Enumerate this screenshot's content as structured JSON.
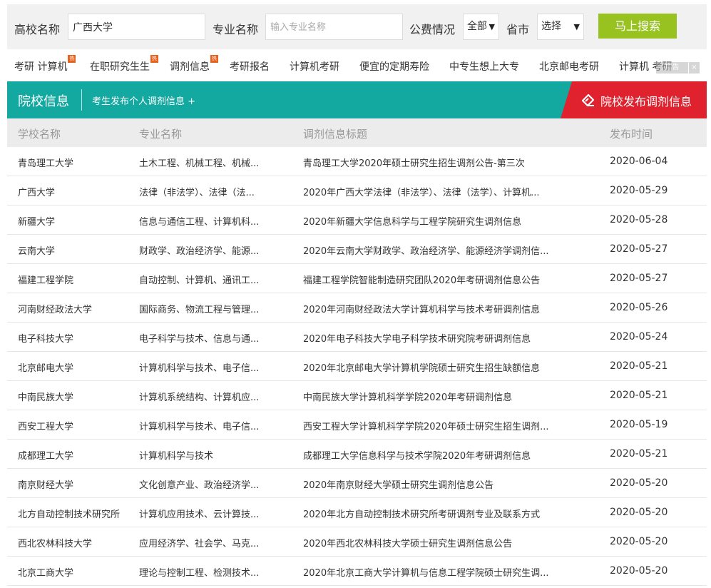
{
  "search": {
    "school_label": "高校名称",
    "school_value": "广西大学",
    "major_label": "专业名称",
    "major_placeholder": "输入专业名称",
    "funding_label": "公费情况",
    "funding_selected": "全部",
    "province_label": "省市",
    "province_selected": "选择",
    "submit_label": "马上搜索"
  },
  "hotlinks": [
    {
      "label": "考研 计算机",
      "hot": "热"
    },
    {
      "label": "在职研究生生",
      "hot": "热"
    },
    {
      "label": "调剂信息",
      "hot": "热"
    },
    {
      "label": "考研报名",
      "hot": ""
    },
    {
      "label": "计算机考研",
      "hot": ""
    },
    {
      "label": "便宜的定期寿险",
      "hot": ""
    },
    {
      "label": "中专生想上大专",
      "hot": ""
    },
    {
      "label": "北京邮电考研",
      "hot": ""
    },
    {
      "label": "计算机 考研",
      "hot": ""
    }
  ],
  "ad": {
    "label": "广告",
    "close": "×"
  },
  "tabs": {
    "title": "院校信息",
    "publish_personal": "考生发布个人调剂信息 +",
    "publish_school": "院校发布调剂信息"
  },
  "table": {
    "headers": [
      "学校名称",
      "专业名称",
      "调剂信息标题",
      "发布时间"
    ],
    "rows": [
      [
        "青岛理工大学",
        "土木工程、机械工程、机械...",
        "青岛理工大学2020年硕士研究生招生调剂公告-第三次",
        "2020-06-04"
      ],
      [
        "广西大学",
        "法律（非法学）、法律（法...",
        "2020年广西大学法律（非法学）、法律（法学）、计算机...",
        "2020-05-29"
      ],
      [
        "新疆大学",
        "信息与通信工程、计算机科...",
        "2020年新疆大学信息科学与工程学院研究生调剂信息",
        "2020-05-28"
      ],
      [
        "云南大学",
        "财政学、政治经济学、能源...",
        "2020年云南大学财政学、政治经济学、能源经济学调剂信...",
        "2020-05-27"
      ],
      [
        "福建工程学院",
        "自动控制、计算机、通讯工...",
        "福建工程学院智能制造研究团队2020年考研调剂信息公告",
        "2020-05-27"
      ],
      [
        "河南财经政法大学",
        "国际商务、物流工程与管理...",
        "2020年河南财经政法大学计算机科学与技术考研调剂信息",
        "2020-05-26"
      ],
      [
        "电子科技大学",
        "电子科学与技术、信息与通...",
        "2020年电子科技大学电子科学技术研究院考研调剂信息",
        "2020-05-24"
      ],
      [
        "北京邮电大学",
        "计算机科学与技术、电子信...",
        "2020年北京邮电大学计算机学院硕士研究生招生缺额信息",
        "2020-05-21"
      ],
      [
        "中南民族大学",
        "计算机系统结构、计算机应...",
        "中南民族大学计算机科学学院2020年考研调剂信息",
        "2020-05-21"
      ],
      [
        "西安工程大学",
        "计算机科学与技术、电子信...",
        "西安工程大学计算机科学学院2020年硕士研究生招生调剂...",
        "2020-05-19"
      ],
      [
        "成都理工大学",
        "计算机科学与技术",
        "成都理工大学信息科学与技术学院2020年考研调剂信息",
        "2020-05-21"
      ],
      [
        "南京财经大学",
        "文化创意产业、政治经济学...",
        "2020年南京财经大学硕士研究生调剂信息公告",
        "2020-05-20"
      ],
      [
        "北方自动控制技术研究所",
        "计算机应用技术、云计算技...",
        "2020年北方自动控制技术研究所考研调剂专业及联系方式",
        "2020-05-20"
      ],
      [
        "西北农林科技大学",
        "应用经济学、社会学、马克...",
        "2020年西北农林科技大学硕士研究生调剂信息公告",
        "2020-05-20"
      ],
      [
        "北京工商大学",
        "理论与控制工程、检测技术...",
        "2020年北京工商大学计算机与信息工程学院硕士研究生调...",
        "2020-05-20"
      ]
    ]
  },
  "colors": {
    "teal": "#13a8a0",
    "red": "#e0222f",
    "green_button": "#97c21f",
    "hot_badge": "#e9621d"
  }
}
